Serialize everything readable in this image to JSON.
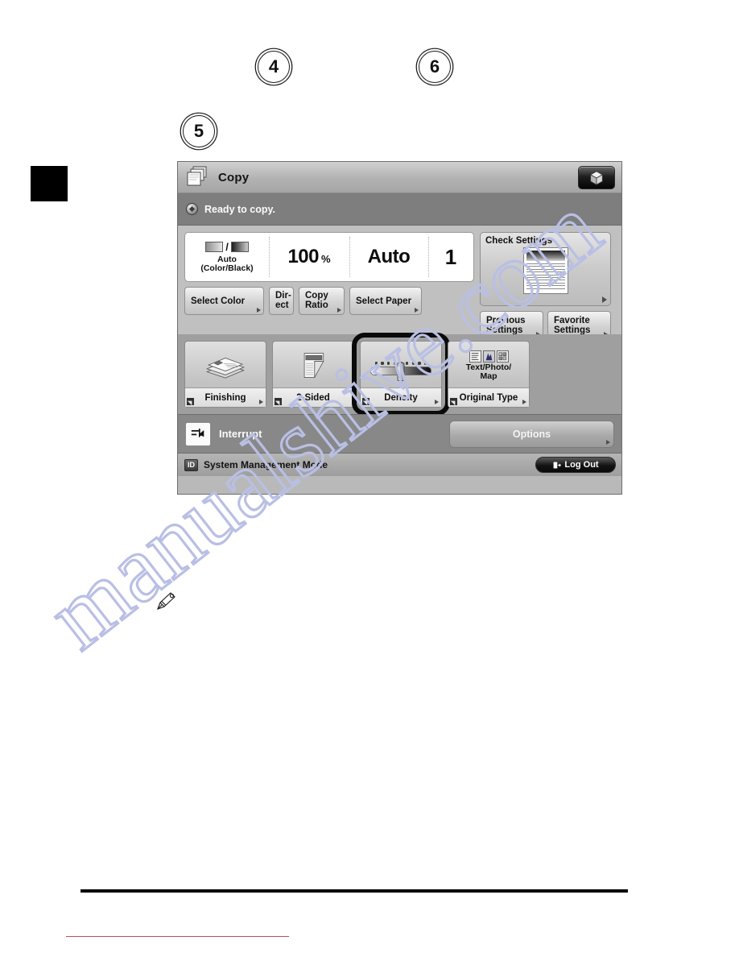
{
  "callouts": [
    {
      "id": "4",
      "label": "4"
    },
    {
      "id": "5",
      "label": "5"
    },
    {
      "id": "6",
      "label": "6"
    }
  ],
  "panel": {
    "titlebar": {
      "title": "Copy",
      "icon": "copy-documents-icon",
      "cube_button_icon": "3d-cube-icon"
    },
    "status": {
      "text": "Ready to copy.",
      "icon": "status-indicator-icon"
    },
    "values": {
      "color_mode_label": "Auto\n(Color/Black)",
      "color_mode_line1": "Auto",
      "color_mode_line2": "(Color/Black)",
      "copy_ratio": "100",
      "copy_ratio_unit": "%",
      "paper": "Auto",
      "copies": "1"
    },
    "buttons": {
      "select_color": "Select Color",
      "direct_line1": "Dir-",
      "direct_line2": "ect",
      "copy_ratio_line1": "Copy",
      "copy_ratio_line2": "Ratio",
      "select_paper": "Select Paper",
      "check_settings": "Check Settings",
      "previous_settings_line1": "Previous",
      "previous_settings_line2": "Settings",
      "favorite_settings_line1": "Favorite",
      "favorite_settings_line2": "Settings",
      "options": "Options",
      "interrupt": "Interrupt",
      "log_out": "Log Out"
    },
    "tiles": [
      {
        "name": "finishing",
        "caption": "Finishing",
        "icon": "finishing-stack-icon",
        "highlighted": false
      },
      {
        "name": "2-sided",
        "caption": "2-Sided",
        "icon": "two-sided-page-icon",
        "highlighted": false
      },
      {
        "name": "density",
        "caption": "Density",
        "icon": "density-slider-icon",
        "highlighted": true
      },
      {
        "name": "original-type",
        "caption": "Original Type",
        "icon": "original-type-icon",
        "value_line1": "Text/Photo/",
        "value_line2": "Map",
        "highlighted": false
      }
    ],
    "density": {
      "dot_count": 9,
      "position": 5
    },
    "footer": {
      "id_badge": "ID",
      "mode_text": "System Management Mode"
    }
  },
  "watermark": {
    "text": "manualshive.com"
  },
  "colors": {
    "panel_bg": "#b9b9b9",
    "titlebar": "#c0c0c0",
    "statusbar": "#7e7e7e",
    "tiles_bg": "#9f9f9f",
    "highlight_ring": "#0a0a0a",
    "rule_red": "#c8485f",
    "watermark": "#b9bfe4"
  }
}
